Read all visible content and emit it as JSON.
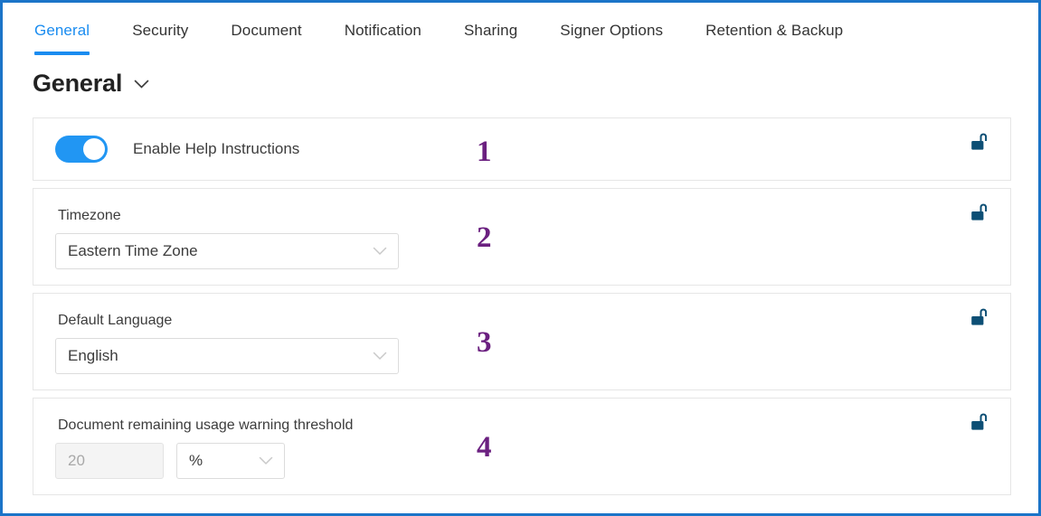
{
  "window": {
    "frame_color": "#1b74c8"
  },
  "tabs": [
    {
      "label": "General",
      "active": true
    },
    {
      "label": "Security",
      "active": false
    },
    {
      "label": "Document",
      "active": false
    },
    {
      "label": "Notification",
      "active": false
    },
    {
      "label": "Sharing",
      "active": false
    },
    {
      "label": "Signer Options",
      "active": false
    },
    {
      "label": "Retention & Backup",
      "active": false
    }
  ],
  "heading": {
    "title": "General",
    "chevron_icon": "chevron-down-icon"
  },
  "colors": {
    "accent_blue": "#1a8cf0",
    "toggle_on": "#2196f3",
    "lock_icon": "#0d4f75",
    "step_number": "#6b2080"
  },
  "settings": [
    {
      "step": "1",
      "type": "toggle",
      "label": "Enable Help Instructions",
      "toggle_state": "on",
      "lock_icon": "unlock-icon"
    },
    {
      "step": "2",
      "type": "dropdown",
      "label": "Timezone",
      "value": "Eastern Time Zone",
      "chevron_icon": "chevron-down-icon",
      "lock_icon": "unlock-icon"
    },
    {
      "step": "3",
      "type": "dropdown",
      "label": "Default Language",
      "value": "English",
      "chevron_icon": "chevron-down-icon",
      "lock_icon": "unlock-icon"
    },
    {
      "step": "4",
      "type": "number-with-unit",
      "label": "Document remaining usage warning threshold",
      "number_placeholder": "20",
      "number_value": "",
      "unit_value": "%",
      "chevron_icon": "chevron-down-icon",
      "lock_icon": "unlock-icon"
    }
  ]
}
